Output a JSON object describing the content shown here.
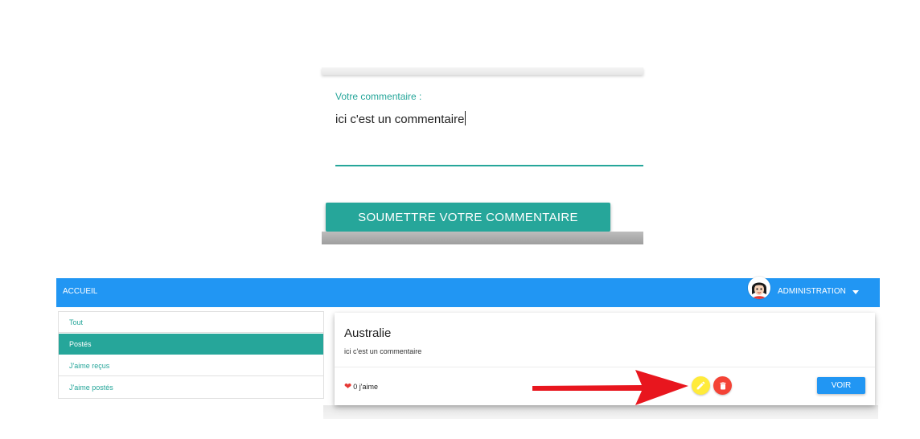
{
  "comment_form": {
    "label": "Votre commentaire :",
    "value": "ici c'est un commentaire",
    "submit_label": "SOUMETTRE VOTRE COMMENTAIRE"
  },
  "navbar": {
    "home_label": "ACCUEIL",
    "admin_label": "ADMINISTRATION",
    "avatar_icon": "user-avatar-icon",
    "caret_icon": "caret-down-icon",
    "color": "#2196f3"
  },
  "sidebar": {
    "items": [
      {
        "label": "Tout",
        "active": false
      },
      {
        "label": "Postés",
        "active": true
      },
      {
        "label": "J'aime reçus",
        "active": false
      },
      {
        "label": "J'aime postés",
        "active": false
      }
    ],
    "accent_color": "#26a69a"
  },
  "post": {
    "title": "Australie",
    "text": "ici c'est un commentaire",
    "likes": "0 j'aime",
    "like_icon": "heart-icon",
    "edit_icon": "pencil-icon",
    "delete_icon": "trash-icon",
    "view_label": "VOIR"
  },
  "annotation": {
    "icon": "red-arrow-icon",
    "color": "#e8161e"
  }
}
